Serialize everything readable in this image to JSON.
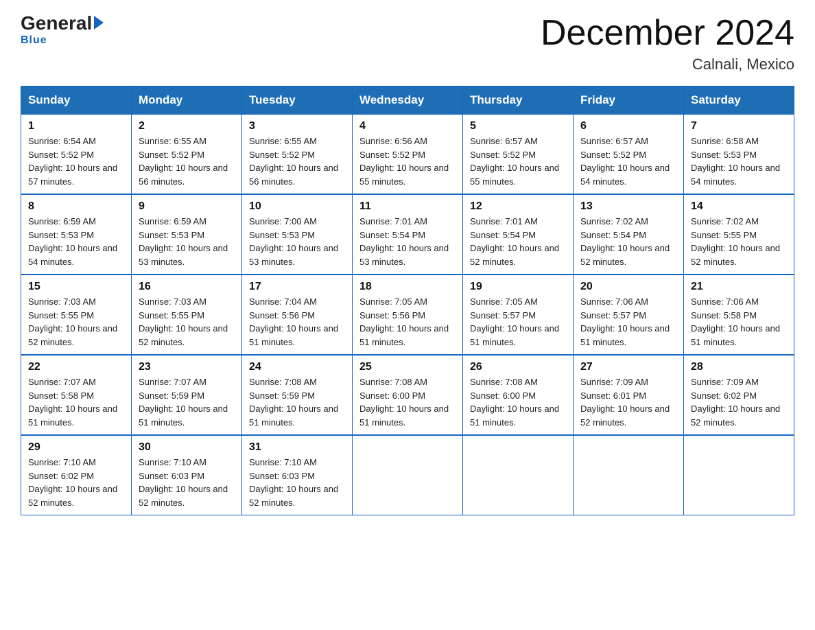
{
  "header": {
    "logo_general": "General",
    "logo_blue": "Blue",
    "month_title": "December 2024",
    "location": "Calnali, Mexico"
  },
  "calendar": {
    "weekdays": [
      "Sunday",
      "Monday",
      "Tuesday",
      "Wednesday",
      "Thursday",
      "Friday",
      "Saturday"
    ],
    "weeks": [
      [
        {
          "day": 1,
          "sunrise": "6:54 AM",
          "sunset": "5:52 PM",
          "daylight": "10 hours and 57 minutes."
        },
        {
          "day": 2,
          "sunrise": "6:55 AM",
          "sunset": "5:52 PM",
          "daylight": "10 hours and 56 minutes."
        },
        {
          "day": 3,
          "sunrise": "6:55 AM",
          "sunset": "5:52 PM",
          "daylight": "10 hours and 56 minutes."
        },
        {
          "day": 4,
          "sunrise": "6:56 AM",
          "sunset": "5:52 PM",
          "daylight": "10 hours and 55 minutes."
        },
        {
          "day": 5,
          "sunrise": "6:57 AM",
          "sunset": "5:52 PM",
          "daylight": "10 hours and 55 minutes."
        },
        {
          "day": 6,
          "sunrise": "6:57 AM",
          "sunset": "5:52 PM",
          "daylight": "10 hours and 54 minutes."
        },
        {
          "day": 7,
          "sunrise": "6:58 AM",
          "sunset": "5:53 PM",
          "daylight": "10 hours and 54 minutes."
        }
      ],
      [
        {
          "day": 8,
          "sunrise": "6:59 AM",
          "sunset": "5:53 PM",
          "daylight": "10 hours and 54 minutes."
        },
        {
          "day": 9,
          "sunrise": "6:59 AM",
          "sunset": "5:53 PM",
          "daylight": "10 hours and 53 minutes."
        },
        {
          "day": 10,
          "sunrise": "7:00 AM",
          "sunset": "5:53 PM",
          "daylight": "10 hours and 53 minutes."
        },
        {
          "day": 11,
          "sunrise": "7:01 AM",
          "sunset": "5:54 PM",
          "daylight": "10 hours and 53 minutes."
        },
        {
          "day": 12,
          "sunrise": "7:01 AM",
          "sunset": "5:54 PM",
          "daylight": "10 hours and 52 minutes."
        },
        {
          "day": 13,
          "sunrise": "7:02 AM",
          "sunset": "5:54 PM",
          "daylight": "10 hours and 52 minutes."
        },
        {
          "day": 14,
          "sunrise": "7:02 AM",
          "sunset": "5:55 PM",
          "daylight": "10 hours and 52 minutes."
        }
      ],
      [
        {
          "day": 15,
          "sunrise": "7:03 AM",
          "sunset": "5:55 PM",
          "daylight": "10 hours and 52 minutes."
        },
        {
          "day": 16,
          "sunrise": "7:03 AM",
          "sunset": "5:55 PM",
          "daylight": "10 hours and 52 minutes."
        },
        {
          "day": 17,
          "sunrise": "7:04 AM",
          "sunset": "5:56 PM",
          "daylight": "10 hours and 51 minutes."
        },
        {
          "day": 18,
          "sunrise": "7:05 AM",
          "sunset": "5:56 PM",
          "daylight": "10 hours and 51 minutes."
        },
        {
          "day": 19,
          "sunrise": "7:05 AM",
          "sunset": "5:57 PM",
          "daylight": "10 hours and 51 minutes."
        },
        {
          "day": 20,
          "sunrise": "7:06 AM",
          "sunset": "5:57 PM",
          "daylight": "10 hours and 51 minutes."
        },
        {
          "day": 21,
          "sunrise": "7:06 AM",
          "sunset": "5:58 PM",
          "daylight": "10 hours and 51 minutes."
        }
      ],
      [
        {
          "day": 22,
          "sunrise": "7:07 AM",
          "sunset": "5:58 PM",
          "daylight": "10 hours and 51 minutes."
        },
        {
          "day": 23,
          "sunrise": "7:07 AM",
          "sunset": "5:59 PM",
          "daylight": "10 hours and 51 minutes."
        },
        {
          "day": 24,
          "sunrise": "7:08 AM",
          "sunset": "5:59 PM",
          "daylight": "10 hours and 51 minutes."
        },
        {
          "day": 25,
          "sunrise": "7:08 AM",
          "sunset": "6:00 PM",
          "daylight": "10 hours and 51 minutes."
        },
        {
          "day": 26,
          "sunrise": "7:08 AM",
          "sunset": "6:00 PM",
          "daylight": "10 hours and 51 minutes."
        },
        {
          "day": 27,
          "sunrise": "7:09 AM",
          "sunset": "6:01 PM",
          "daylight": "10 hours and 52 minutes."
        },
        {
          "day": 28,
          "sunrise": "7:09 AM",
          "sunset": "6:02 PM",
          "daylight": "10 hours and 52 minutes."
        }
      ],
      [
        {
          "day": 29,
          "sunrise": "7:10 AM",
          "sunset": "6:02 PM",
          "daylight": "10 hours and 52 minutes."
        },
        {
          "day": 30,
          "sunrise": "7:10 AM",
          "sunset": "6:03 PM",
          "daylight": "10 hours and 52 minutes."
        },
        {
          "day": 31,
          "sunrise": "7:10 AM",
          "sunset": "6:03 PM",
          "daylight": "10 hours and 52 minutes."
        },
        null,
        null,
        null,
        null
      ]
    ]
  }
}
